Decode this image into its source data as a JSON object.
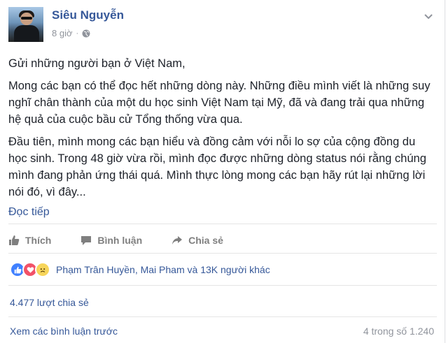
{
  "post": {
    "author": "Siêu Nguyễn",
    "time": "8 giờ",
    "dot": "·",
    "icons": {
      "privacy": "globe-icon",
      "menu": "chevron-down-icon"
    },
    "paragraphs": [
      "Gửi những người bạn ở Việt Nam,",
      "Mong các bạn có thể đọc hết những dòng này. Những điều mình viết là những suy nghĩ chân thành của một du học sinh Việt Nam tại Mỹ, đã và đang trải qua những hệ quả của cuộc bầu cử Tổng thống vừa qua.",
      "Đầu tiên, mình mong các bạn hiểu và đồng cảm với nỗi lo sợ của cộng đồng du học sinh. Trong 48 giờ vừa rồi, mình đọc được những dòng status nói rằng chúng mình đang phản ứng thái quá. Mình thực lòng mong các bạn hãy rút lại những lời nói đó, vì đây..."
    ],
    "read_more": "Đọc tiếp"
  },
  "actions": {
    "like": "Thích",
    "comment": "Bình luận",
    "share": "Chia sẻ"
  },
  "reactions": {
    "types": [
      "like",
      "love",
      "sad"
    ],
    "summary": "Phạm Trân Huyền, Mai Pham và 13K người khác"
  },
  "shares": "4.477 lượt chia sẻ",
  "comments": {
    "view_previous": "Xem các bình luận trước",
    "count": "4 trong số 1.240"
  },
  "colors": {
    "link": "#365899",
    "muted": "#90949c",
    "text": "#1d2129",
    "like": "#4080ff",
    "love": "#f25268",
    "sad": "#f7d55a"
  }
}
